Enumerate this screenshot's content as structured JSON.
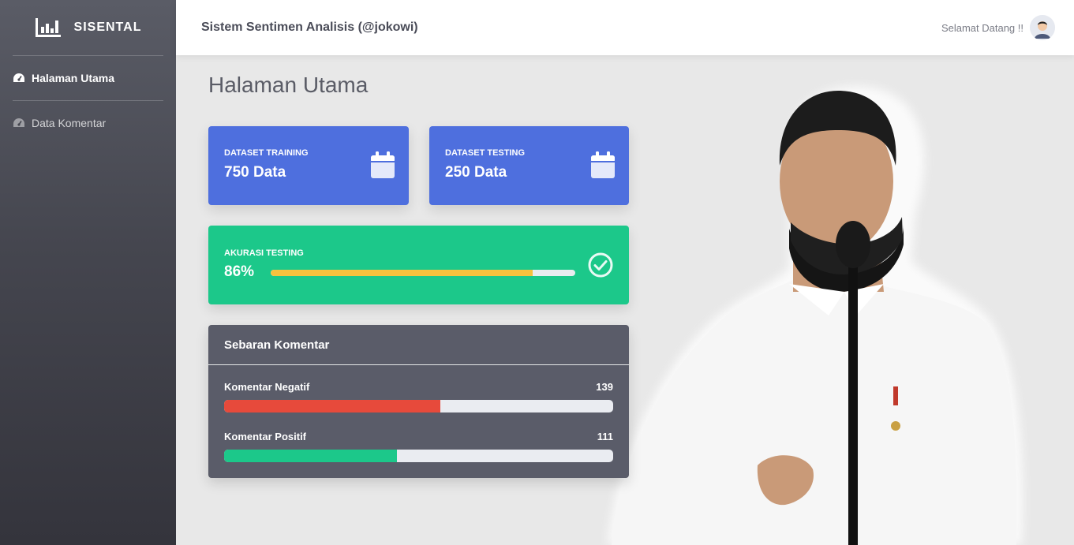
{
  "brand": {
    "name": "SISENTAL",
    "icon": "bar-chart-icon"
  },
  "sidebar": {
    "items": [
      {
        "label": "Halaman Utama",
        "icon": "tachometer-icon",
        "active": true
      },
      {
        "label": "Data Komentar",
        "icon": "tachometer-icon",
        "active": false
      }
    ]
  },
  "topbar": {
    "title": "Sistem Sentimen Analisis (@jokowi)",
    "welcome": "Selamat Datang !!",
    "avatar_icon": "user-avatar-icon"
  },
  "page": {
    "title": "Halaman Utama"
  },
  "cards": {
    "training": {
      "label": "DATASET TRAINING",
      "value": "750 Data",
      "icon": "calendar-icon"
    },
    "testing": {
      "label": "DATASET TESTING",
      "value": "250 Data",
      "icon": "calendar-icon"
    },
    "accuracy": {
      "label": "AKURASI TESTING",
      "value": "86%",
      "progress": 0.86,
      "icon": "check-circle-icon"
    }
  },
  "distribution": {
    "title": "Sebaran Komentar",
    "rows": [
      {
        "label": "Komentar Negatif",
        "count": "139",
        "fraction": 0.556
      },
      {
        "label": "Komentar Positif",
        "count": "111",
        "fraction": 0.444
      }
    ]
  },
  "colors": {
    "primary": "#4e6fde",
    "success": "#1cc88a",
    "warning": "#f6c23e",
    "danger": "#e74a3b",
    "dark": "#5a5c69"
  }
}
